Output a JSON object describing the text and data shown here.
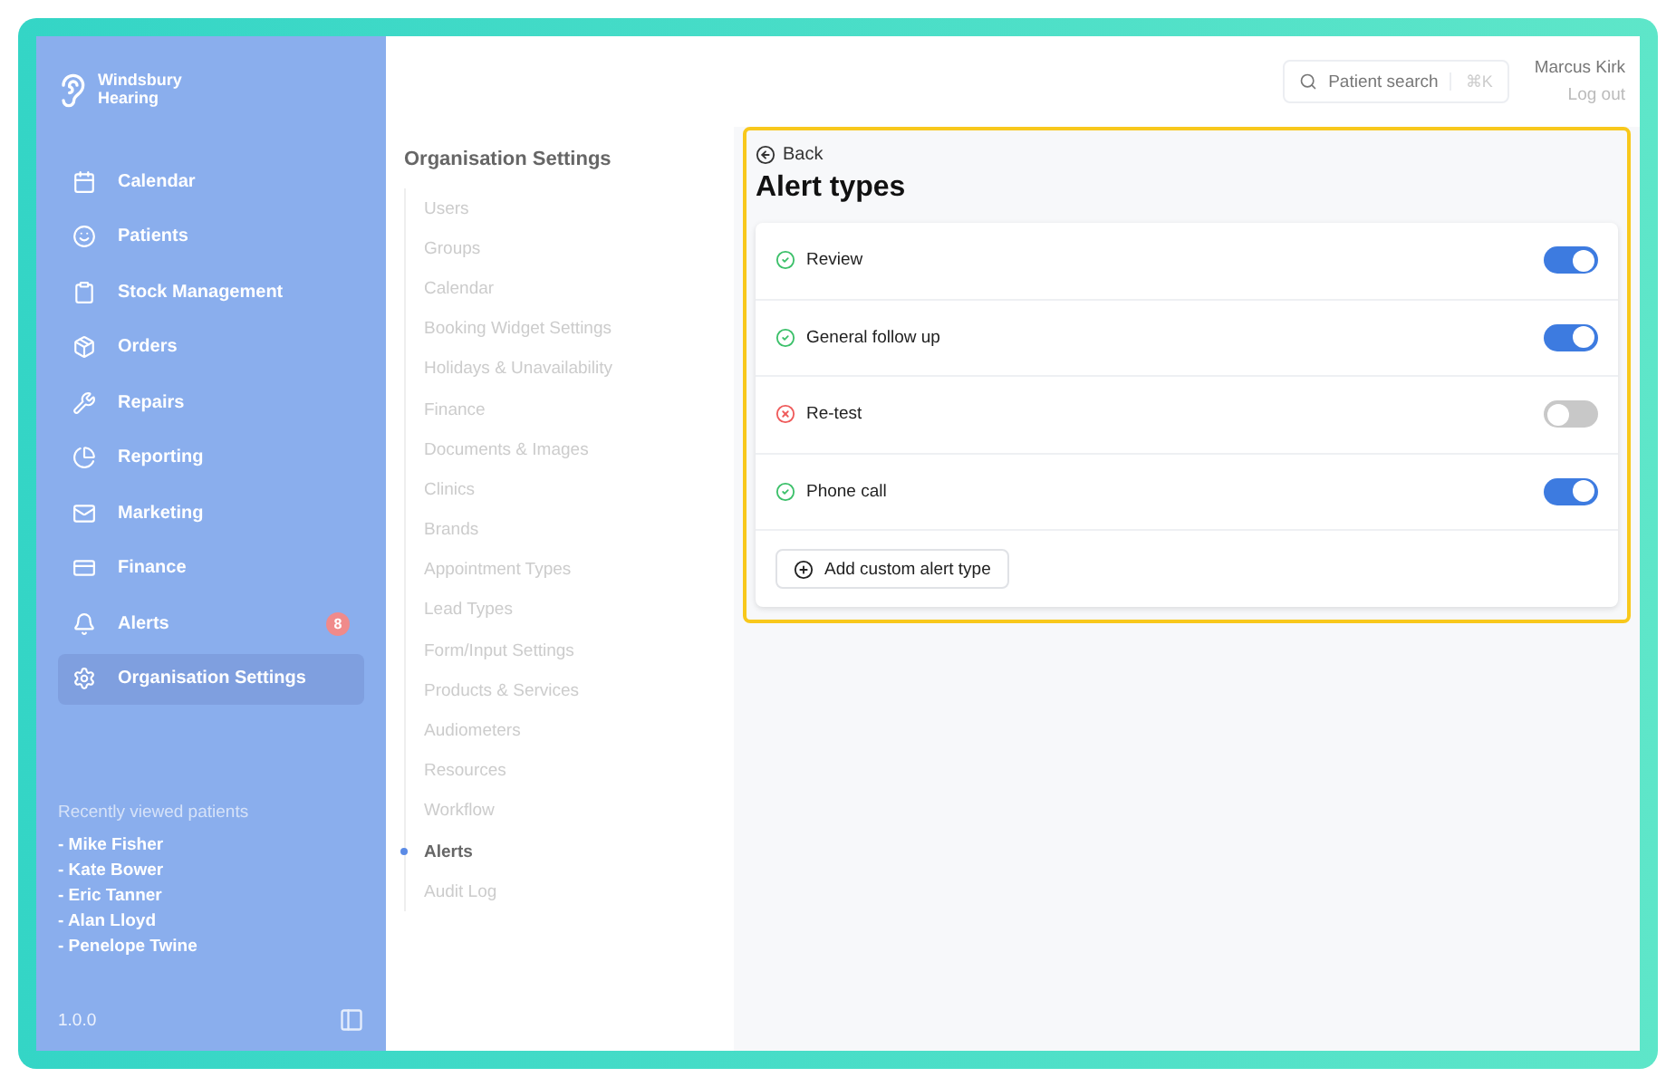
{
  "brand": {
    "name": "Windsbury Hearing"
  },
  "sidebar": {
    "items": [
      {
        "label": "Calendar",
        "selected": false
      },
      {
        "label": "Patients",
        "selected": false
      },
      {
        "label": "Stock Management",
        "selected": false
      },
      {
        "label": "Orders",
        "selected": false
      },
      {
        "label": "Repairs",
        "selected": false
      },
      {
        "label": "Reporting",
        "selected": false
      },
      {
        "label": "Marketing",
        "selected": false
      },
      {
        "label": "Finance",
        "selected": false
      },
      {
        "label": "Alerts",
        "selected": false,
        "badge": "8"
      },
      {
        "label": "Organisation Settings",
        "selected": true
      }
    ],
    "recent_title": "Recently viewed patients",
    "recent": [
      "- Mike Fisher",
      "- Kate Bower",
      "- Eric Tanner",
      "- Alan Lloyd",
      "- Penelope Twine"
    ],
    "version": "1.0.0"
  },
  "header": {
    "search": {
      "placeholder": "Patient search",
      "shortcut": "⌘K"
    },
    "user": "Marcus Kirk",
    "logout": "Log out"
  },
  "settings_nav": {
    "title": "Organisation Settings",
    "items": [
      {
        "label": "Users",
        "selected": false
      },
      {
        "label": "Groups",
        "selected": false
      },
      {
        "label": "Calendar",
        "selected": false
      },
      {
        "label": "Booking Widget Settings",
        "selected": false
      },
      {
        "label": "Holidays & Unavailability",
        "selected": false
      },
      {
        "label": "Finance",
        "selected": false
      },
      {
        "label": "Documents & Images",
        "selected": false
      },
      {
        "label": "Clinics",
        "selected": false
      },
      {
        "label": "Brands",
        "selected": false
      },
      {
        "label": "Appointment Types",
        "selected": false
      },
      {
        "label": "Lead Types",
        "selected": false
      },
      {
        "label": "Form/Input Settings",
        "selected": false
      },
      {
        "label": "Products & Services",
        "selected": false
      },
      {
        "label": "Audiometers",
        "selected": false
      },
      {
        "label": "Resources",
        "selected": false
      },
      {
        "label": "Workflow",
        "selected": false
      },
      {
        "label": "Alerts",
        "selected": true
      },
      {
        "label": "Audit Log",
        "selected": false
      }
    ]
  },
  "page": {
    "back": "Back",
    "title": "Alert types",
    "alerts": [
      {
        "name": "Review",
        "on": true
      },
      {
        "name": "General follow up",
        "on": true
      },
      {
        "name": "Re-test",
        "on": false
      },
      {
        "name": "Phone call",
        "on": true
      }
    ],
    "add_button": "Add custom alert type"
  }
}
